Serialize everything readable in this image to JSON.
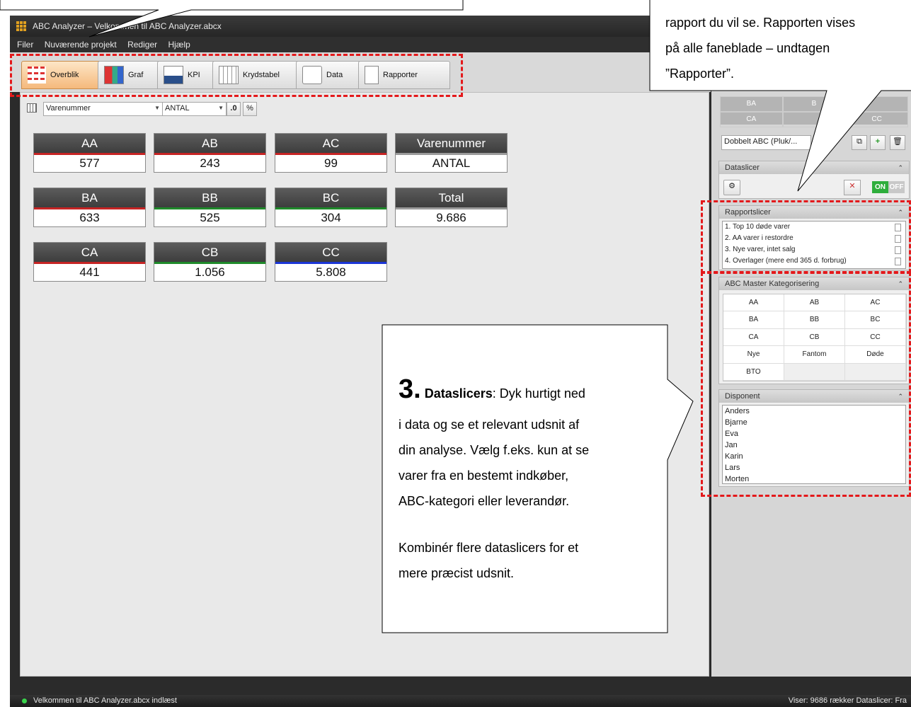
{
  "window": {
    "title": "ABC Analyzer – Velkommen til ABC Analyzer.abcx"
  },
  "menu": [
    "Filer",
    "Nuværende projekt",
    "Rediger",
    "Hjælp"
  ],
  "tabs": [
    "Overblik",
    "Graf",
    "KPI",
    "Krydstabel",
    "Data",
    "Rapporter"
  ],
  "toolbar": {
    "dimension": "Varenummer",
    "measure": "ANTAL",
    "decimals_btn": ".0",
    "percent_btn": "%"
  },
  "matrix": [
    {
      "label": "AA",
      "value": "577",
      "color": "#c62424"
    },
    {
      "label": "AB",
      "value": "243",
      "color": "#c62424"
    },
    {
      "label": "AC",
      "value": "99",
      "color": "#c62424"
    },
    {
      "label": "Varenummer",
      "value": "ANTAL",
      "color": "#9a9a9a"
    },
    {
      "label": "BA",
      "value": "633",
      "color": "#c62424"
    },
    {
      "label": "BB",
      "value": "525",
      "color": "#1f8a2a"
    },
    {
      "label": "BC",
      "value": "304",
      "color": "#1f8a2a"
    },
    {
      "label": "Total",
      "value": "9.686",
      "color": "#9a9a9a"
    },
    {
      "label": "CA",
      "value": "441",
      "color": "#c62424"
    },
    {
      "label": "CB",
      "value": "1.056",
      "color": "#1f8a2a"
    },
    {
      "label": "CC",
      "value": "5.808",
      "color": "#1b36d6"
    }
  ],
  "side": {
    "mini_grid": [
      "BA",
      "B",
      "CA",
      "CC"
    ],
    "report_select": "Dobbelt ABC (Pluk/...",
    "dataslicer_header": "Dataslicer",
    "toggle_on": "ON",
    "toggle_off": "OFF",
    "rapportslicer_header": "Rapportslicer",
    "reports": [
      "1. Top 10 døde varer",
      "2. AA varer i restordre",
      "3. Nye varer, intet salg",
      "4. Overlager (mere end 365 d. forbrug)"
    ],
    "abc_header": "ABC Master Kategorisering",
    "abc_items": [
      "AA",
      "AB",
      "AC",
      "BA",
      "BB",
      "BC",
      "CA",
      "CB",
      "CC",
      "Nye",
      "Fantom",
      "Døde",
      "BTO"
    ],
    "disponent_header": "Disponent",
    "disponents": [
      "Anders",
      "Bjarne",
      "Eva",
      "Jan",
      "Karin",
      "Lars",
      "Morten"
    ]
  },
  "status": {
    "left": "Velkommen til ABC Analyzer.abcx indlæst",
    "right": "Viser: 9686 rækker   Dataslicer: Fra"
  },
  "callout_top_right": {
    "line1": "rapport du vil se. Rapporten vises",
    "line2": "på alle faneblade – undtagen",
    "line3": "”Rapporter”."
  },
  "callout_main": {
    "number": "3.",
    "heading": "Dataslicers",
    "line1": ": Dyk hurtigt ned",
    "line2": "i data og se et relevant udsnit af",
    "line3": "din analyse. Vælg f.eks. kun at se",
    "line4": "varer fra en bestemt indkøber,",
    "line5": "ABC-kategori eller leverandør.",
    "line6": "Kombinér flere dataslicers for et",
    "line7": "mere præcist udsnit."
  }
}
